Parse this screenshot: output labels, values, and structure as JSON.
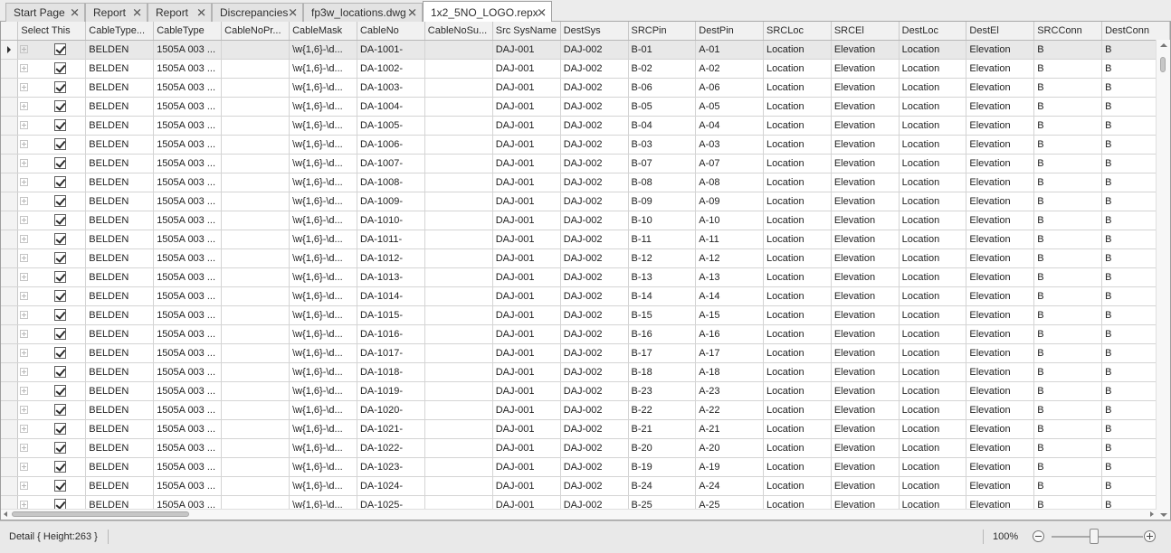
{
  "tabs": [
    {
      "label": "Start Page",
      "active": false
    },
    {
      "label": "Report",
      "active": false
    },
    {
      "label": "Report",
      "active": false
    },
    {
      "label": "Discrepancies",
      "active": false
    },
    {
      "label": "fp3w_locations.dwg",
      "active": false
    },
    {
      "label": "1x2_5NO_LOGO.repx",
      "active": true
    }
  ],
  "icons": {
    "tab_close": "close-icon",
    "close_glyph": "✕",
    "expand": "expand-plus-icon",
    "check": "checkbox-checked-icon",
    "focused_row": "row-indicator-arrow-icon"
  },
  "grid": {
    "columns": [
      "Select This",
      "CableType...",
      "CableType",
      "CableNoPr...",
      "CableMask",
      "CableNo",
      "CableNoSu...",
      "Src SysName",
      "DestSys",
      "SRCPin",
      "DestPin",
      "SRCLoc",
      "SRCEl",
      "DestLoc",
      "DestEl",
      "SRCConn",
      "DestConn"
    ],
    "rows": [
      [
        "BELDEN",
        "1505A 003 ...",
        "",
        "\\w{1,6}-\\d...",
        "DA-1001-",
        "",
        "DAJ-001",
        "DAJ-002",
        "B-01",
        "A-01",
        "Location",
        "Elevation",
        "Location",
        "Elevation",
        "B",
        "B"
      ],
      [
        "BELDEN",
        "1505A 003 ...",
        "",
        "\\w{1,6}-\\d...",
        "DA-1002-",
        "",
        "DAJ-001",
        "DAJ-002",
        "B-02",
        "A-02",
        "Location",
        "Elevation",
        "Location",
        "Elevation",
        "B",
        "B"
      ],
      [
        "BELDEN",
        "1505A 003 ...",
        "",
        "\\w{1,6}-\\d...",
        "DA-1003-",
        "",
        "DAJ-001",
        "DAJ-002",
        "B-06",
        "A-06",
        "Location",
        "Elevation",
        "Location",
        "Elevation",
        "B",
        "B"
      ],
      [
        "BELDEN",
        "1505A 003 ...",
        "",
        "\\w{1,6}-\\d...",
        "DA-1004-",
        "",
        "DAJ-001",
        "DAJ-002",
        "B-05",
        "A-05",
        "Location",
        "Elevation",
        "Location",
        "Elevation",
        "B",
        "B"
      ],
      [
        "BELDEN",
        "1505A 003 ...",
        "",
        "\\w{1,6}-\\d...",
        "DA-1005-",
        "",
        "DAJ-001",
        "DAJ-002",
        "B-04",
        "A-04",
        "Location",
        "Elevation",
        "Location",
        "Elevation",
        "B",
        "B"
      ],
      [
        "BELDEN",
        "1505A 003 ...",
        "",
        "\\w{1,6}-\\d...",
        "DA-1006-",
        "",
        "DAJ-001",
        "DAJ-002",
        "B-03",
        "A-03",
        "Location",
        "Elevation",
        "Location",
        "Elevation",
        "B",
        "B"
      ],
      [
        "BELDEN",
        "1505A 003 ...",
        "",
        "\\w{1,6}-\\d...",
        "DA-1007-",
        "",
        "DAJ-001",
        "DAJ-002",
        "B-07",
        "A-07",
        "Location",
        "Elevation",
        "Location",
        "Elevation",
        "B",
        "B"
      ],
      [
        "BELDEN",
        "1505A 003 ...",
        "",
        "\\w{1,6}-\\d...",
        "DA-1008-",
        "",
        "DAJ-001",
        "DAJ-002",
        "B-08",
        "A-08",
        "Location",
        "Elevation",
        "Location",
        "Elevation",
        "B",
        "B"
      ],
      [
        "BELDEN",
        "1505A 003 ...",
        "",
        "\\w{1,6}-\\d...",
        "DA-1009-",
        "",
        "DAJ-001",
        "DAJ-002",
        "B-09",
        "A-09",
        "Location",
        "Elevation",
        "Location",
        "Elevation",
        "B",
        "B"
      ],
      [
        "BELDEN",
        "1505A 003 ...",
        "",
        "\\w{1,6}-\\d...",
        "DA-1010-",
        "",
        "DAJ-001",
        "DAJ-002",
        "B-10",
        "A-10",
        "Location",
        "Elevation",
        "Location",
        "Elevation",
        "B",
        "B"
      ],
      [
        "BELDEN",
        "1505A 003 ...",
        "",
        "\\w{1,6}-\\d...",
        "DA-1011-",
        "",
        "DAJ-001",
        "DAJ-002",
        "B-11",
        "A-11",
        "Location",
        "Elevation",
        "Location",
        "Elevation",
        "B",
        "B"
      ],
      [
        "BELDEN",
        "1505A 003 ...",
        "",
        "\\w{1,6}-\\d...",
        "DA-1012-",
        "",
        "DAJ-001",
        "DAJ-002",
        "B-12",
        "A-12",
        "Location",
        "Elevation",
        "Location",
        "Elevation",
        "B",
        "B"
      ],
      [
        "BELDEN",
        "1505A 003 ...",
        "",
        "\\w{1,6}-\\d...",
        "DA-1013-",
        "",
        "DAJ-001",
        "DAJ-002",
        "B-13",
        "A-13",
        "Location",
        "Elevation",
        "Location",
        "Elevation",
        "B",
        "B"
      ],
      [
        "BELDEN",
        "1505A 003 ...",
        "",
        "\\w{1,6}-\\d...",
        "DA-1014-",
        "",
        "DAJ-001",
        "DAJ-002",
        "B-14",
        "A-14",
        "Location",
        "Elevation",
        "Location",
        "Elevation",
        "B",
        "B"
      ],
      [
        "BELDEN",
        "1505A 003 ...",
        "",
        "\\w{1,6}-\\d...",
        "DA-1015-",
        "",
        "DAJ-001",
        "DAJ-002",
        "B-15",
        "A-15",
        "Location",
        "Elevation",
        "Location",
        "Elevation",
        "B",
        "B"
      ],
      [
        "BELDEN",
        "1505A 003 ...",
        "",
        "\\w{1,6}-\\d...",
        "DA-1016-",
        "",
        "DAJ-001",
        "DAJ-002",
        "B-16",
        "A-16",
        "Location",
        "Elevation",
        "Location",
        "Elevation",
        "B",
        "B"
      ],
      [
        "BELDEN",
        "1505A 003 ...",
        "",
        "\\w{1,6}-\\d...",
        "DA-1017-",
        "",
        "DAJ-001",
        "DAJ-002",
        "B-17",
        "A-17",
        "Location",
        "Elevation",
        "Location",
        "Elevation",
        "B",
        "B"
      ],
      [
        "BELDEN",
        "1505A 003 ...",
        "",
        "\\w{1,6}-\\d...",
        "DA-1018-",
        "",
        "DAJ-001",
        "DAJ-002",
        "B-18",
        "A-18",
        "Location",
        "Elevation",
        "Location",
        "Elevation",
        "B",
        "B"
      ],
      [
        "BELDEN",
        "1505A 003 ...",
        "",
        "\\w{1,6}-\\d...",
        "DA-1019-",
        "",
        "DAJ-001",
        "DAJ-002",
        "B-23",
        "A-23",
        "Location",
        "Elevation",
        "Location",
        "Elevation",
        "B",
        "B"
      ],
      [
        "BELDEN",
        "1505A 003 ...",
        "",
        "\\w{1,6}-\\d...",
        "DA-1020-",
        "",
        "DAJ-001",
        "DAJ-002",
        "B-22",
        "A-22",
        "Location",
        "Elevation",
        "Location",
        "Elevation",
        "B",
        "B"
      ],
      [
        "BELDEN",
        "1505A 003 ...",
        "",
        "\\w{1,6}-\\d...",
        "DA-1021-",
        "",
        "DAJ-001",
        "DAJ-002",
        "B-21",
        "A-21",
        "Location",
        "Elevation",
        "Location",
        "Elevation",
        "B",
        "B"
      ],
      [
        "BELDEN",
        "1505A 003 ...",
        "",
        "\\w{1,6}-\\d...",
        "DA-1022-",
        "",
        "DAJ-001",
        "DAJ-002",
        "B-20",
        "A-20",
        "Location",
        "Elevation",
        "Location",
        "Elevation",
        "B",
        "B"
      ],
      [
        "BELDEN",
        "1505A 003 ...",
        "",
        "\\w{1,6}-\\d...",
        "DA-1023-",
        "",
        "DAJ-001",
        "DAJ-002",
        "B-19",
        "A-19",
        "Location",
        "Elevation",
        "Location",
        "Elevation",
        "B",
        "B"
      ],
      [
        "BELDEN",
        "1505A 003 ...",
        "",
        "\\w{1,6}-\\d...",
        "DA-1024-",
        "",
        "DAJ-001",
        "DAJ-002",
        "B-24",
        "A-24",
        "Location",
        "Elevation",
        "Location",
        "Elevation",
        "B",
        "B"
      ],
      [
        "BELDEN",
        "1505A 003 ...",
        "",
        "\\w{1,6}-\\d...",
        "DA-1025-",
        "",
        "DAJ-001",
        "DAJ-002",
        "B-25",
        "A-25",
        "Location",
        "Elevation",
        "Location",
        "Elevation",
        "B",
        "B"
      ]
    ],
    "focused_row_index": 0
  },
  "status": {
    "detail": "Detail { Height:263 }",
    "zoom": "100%"
  }
}
